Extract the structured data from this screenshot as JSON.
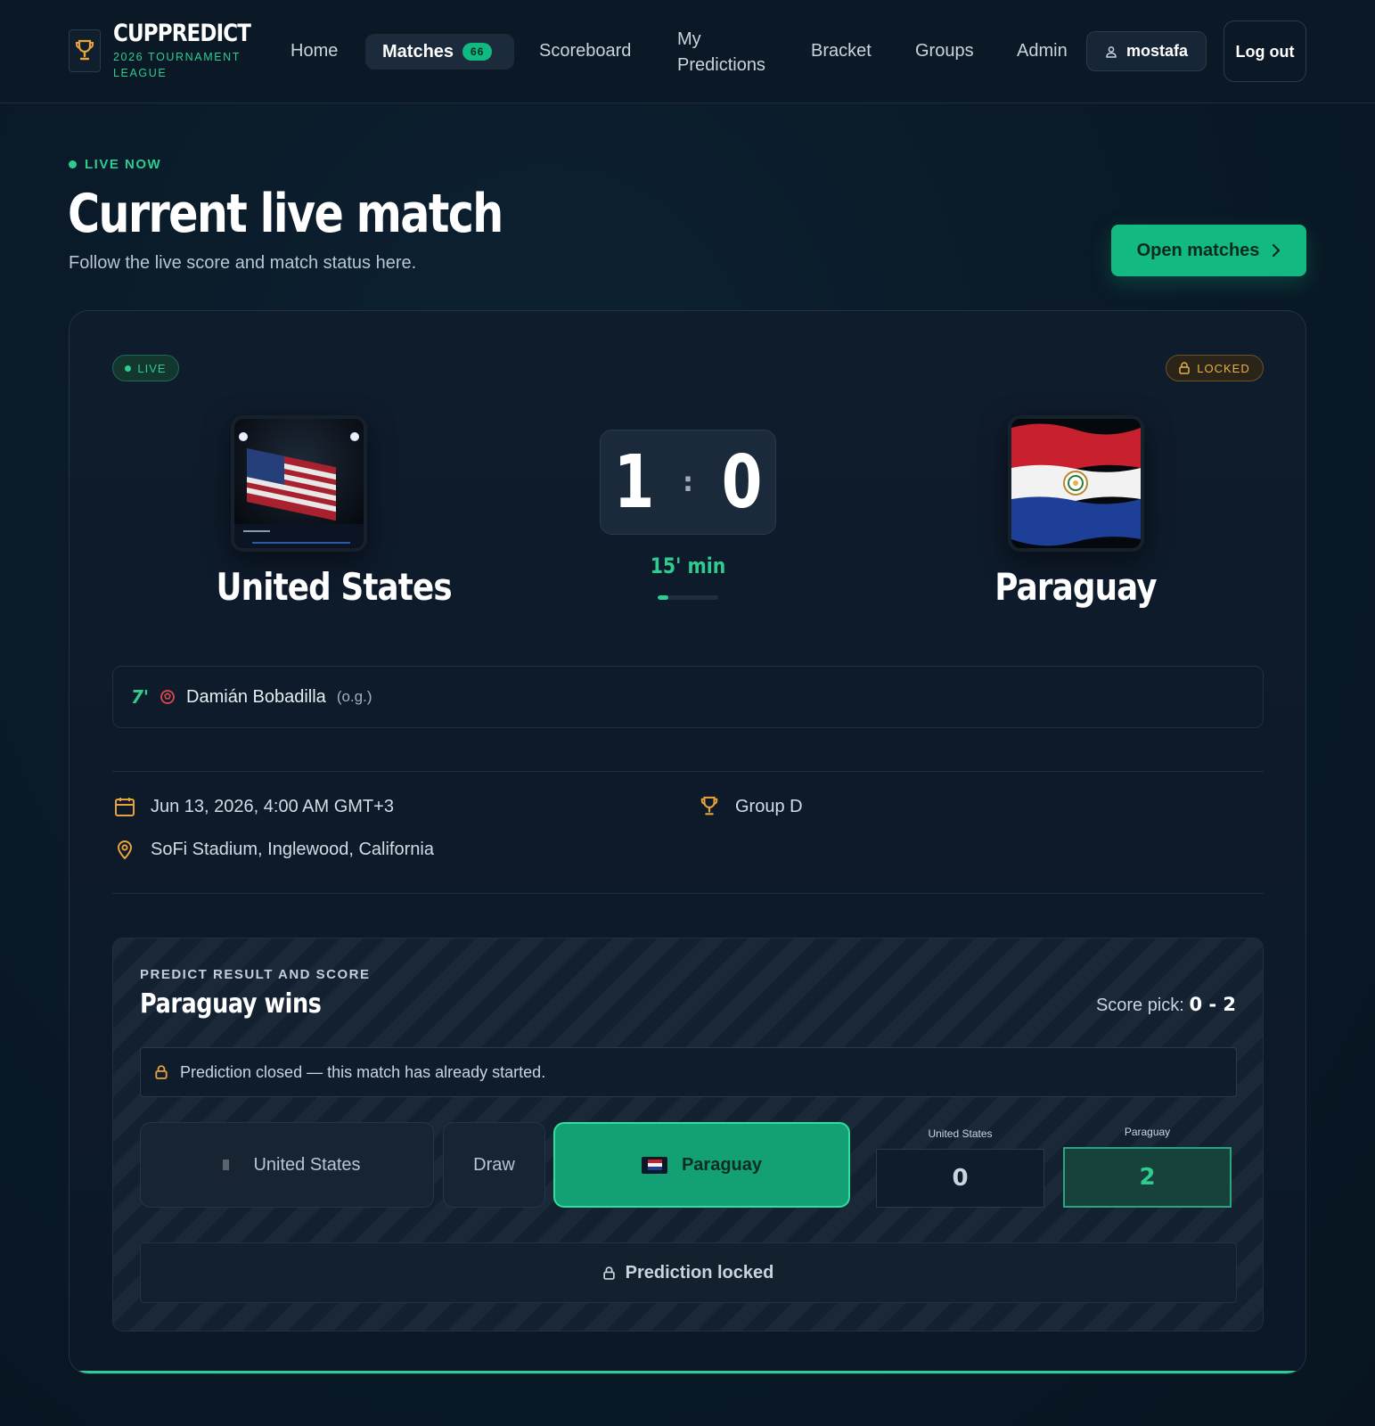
{
  "nav": {
    "brand_name": "CUPPREDICT",
    "brand_sub": "2026 TOURNAMENT LEAGUE",
    "links": {
      "home": "Home",
      "matches": "Matches",
      "matches_count": "66",
      "scoreboard": "Scoreboard",
      "my_predictions": "My Predictions",
      "bracket": "Bracket",
      "groups": "Groups",
      "admin": "Admin"
    },
    "user": "mostafa",
    "logout": "Log out"
  },
  "hero": {
    "eyebrow": "LIVE NOW",
    "title": "Current live match",
    "subtitle": "Follow the live score and match status here.",
    "open_button": "Open matches"
  },
  "match": {
    "status_badge": "LIVE",
    "lock_badge": "LOCKED",
    "home_team": "United States",
    "away_team": "Paraguay",
    "home_score": "1",
    "away_score": "0",
    "separator": ":",
    "minute": "15' min",
    "progress_fraction": 0.17,
    "event": {
      "minute": "7'",
      "player": "Damián Bobadilla",
      "note": "(o.g.)"
    },
    "datetime": "Jun 13, 2026, 4:00 AM GMT+3",
    "group": "Group D",
    "venue": "SoFi Stadium, Inglewood, California"
  },
  "prediction": {
    "label": "PREDICT RESULT AND SCORE",
    "title": "Paraguay wins",
    "score_pick_label": "Score pick:",
    "score_pick_value": "0 - 2",
    "closed_note": "Prediction closed — this match has already started.",
    "options": {
      "home": "United States",
      "draw": "Draw",
      "away": "Paraguay"
    },
    "home_score_label": "United States",
    "away_score_label": "Paraguay",
    "home_score": "0",
    "away_score": "2",
    "locked_label": "Prediction locked"
  },
  "colors": {
    "accent": "#2ecc8f",
    "button": "#12b981",
    "warning": "#e8b04a",
    "background": "#0a1a28"
  }
}
